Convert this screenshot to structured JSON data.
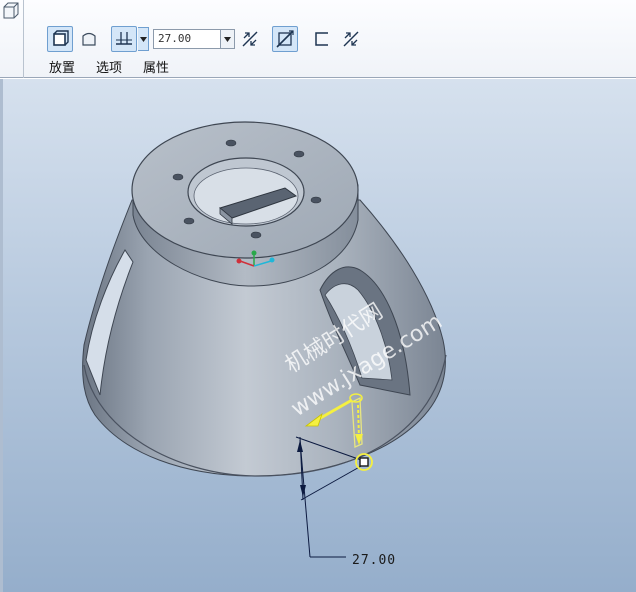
{
  "toolbar": {
    "dimension_value": "27.00",
    "tabs": [
      "放置",
      "选项",
      "属性"
    ]
  },
  "icons": {
    "corner": "feature-corner-icon",
    "solid": "solid-extrude-icon",
    "surface": "surface-extrude-icon",
    "depth": "depth-blind-icon",
    "flip": "flip-direction-icon",
    "remove_material": "remove-material-icon",
    "thicken": "thicken-sketch-icon",
    "flip2": "flip-thicken-icon"
  },
  "viewport": {
    "dimension_label": "27.00",
    "watermark_cn": "机械时代网",
    "watermark_url": "www.jxage.com"
  },
  "colors": {
    "active_button": "#d4e6f8",
    "model_gray": "#a9b3bf",
    "handle_yellow": "#f5f040",
    "background_top": "#d6e1ee",
    "background_bottom": "#95aecb"
  }
}
